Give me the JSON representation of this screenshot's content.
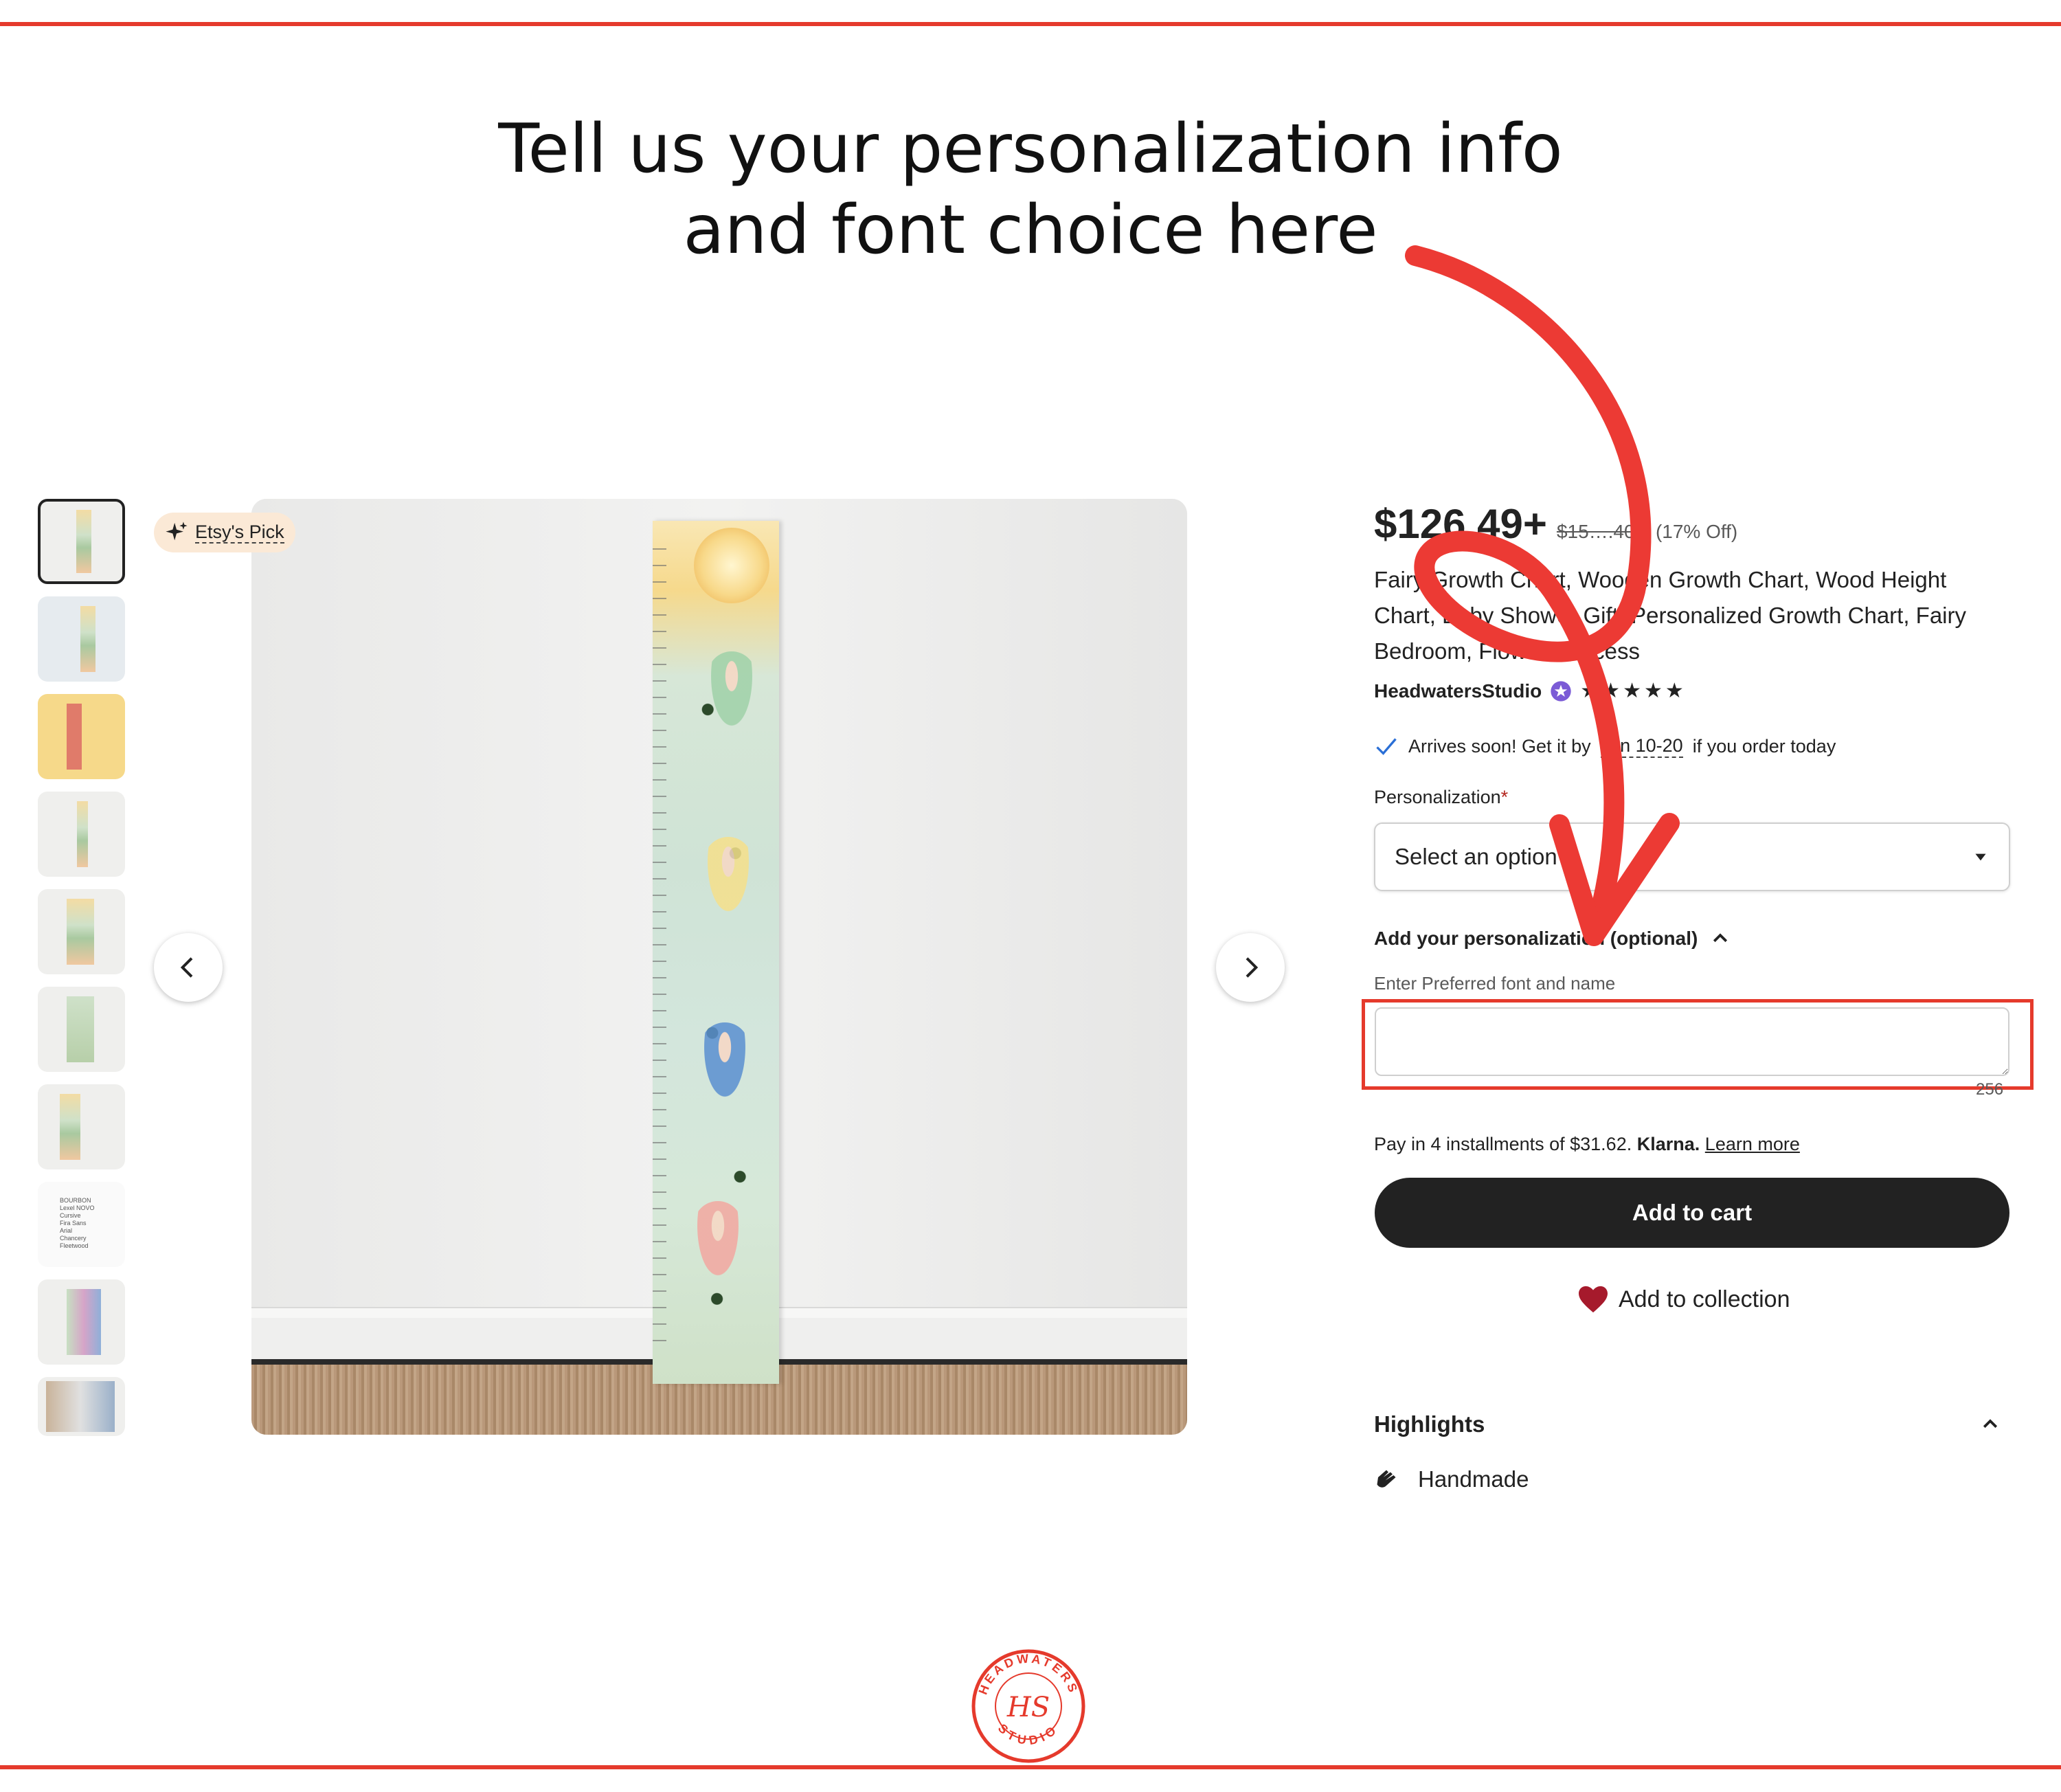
{
  "headline": {
    "line1": "Tell us your personalization info",
    "line2": "and font choice here"
  },
  "gallery": {
    "badge_label": "Etsy's Pick",
    "thumb_font_sample_text": [
      "BOURBON",
      "Lexel NOVO",
      "Cursive",
      "Fira Sans",
      "Arial",
      "Chancery",
      "Fleetwood"
    ],
    "nav_prev_icon": "chevron-left-icon",
    "nav_next_icon": "chevron-right-icon"
  },
  "product": {
    "price": "$126.49+",
    "original_price": "$15….40+",
    "discount": "(17% Off)",
    "title": "Fairy Growth Chart, Wooden Growth Chart, Wood Height Chart, Baby Shower Gift, Personalized Growth Chart, Fairy Bedroom, Flower Princess",
    "shop_name": "HeadwatersStudio",
    "stars": "★★★★★",
    "rating": 5,
    "arrives_prefix": "Arrives soon! Get it by",
    "arrives_date": "Jun 10-20",
    "arrives_suffix": "if you order today"
  },
  "form": {
    "personalization_label": "Personalization",
    "required_mark": "*",
    "select_value": "Select an option",
    "add_personalization_label": "Add your personalization (optional)",
    "enter_label": "Enter Preferred font and name",
    "textarea_value": "",
    "char_counter": "256"
  },
  "payment": {
    "klarna_text": "Pay in 4 installments of $31.62.",
    "klarna_brand": "Klarna.",
    "learn_more": "Learn more"
  },
  "actions": {
    "add_to_cart": "Add to cart",
    "add_to_collection": "Add to collection"
  },
  "highlights": {
    "title": "Highlights",
    "items": [
      "Handmade"
    ]
  },
  "logo": {
    "text": "HEADWATERS STUDIO",
    "monogram": "HS"
  },
  "colors": {
    "accent_red": "#e53a2c",
    "button_dark": "#222222",
    "badge_bg": "#fbe9d6",
    "heart": "#a61a2c",
    "star_seller": "#7b5bd6"
  }
}
